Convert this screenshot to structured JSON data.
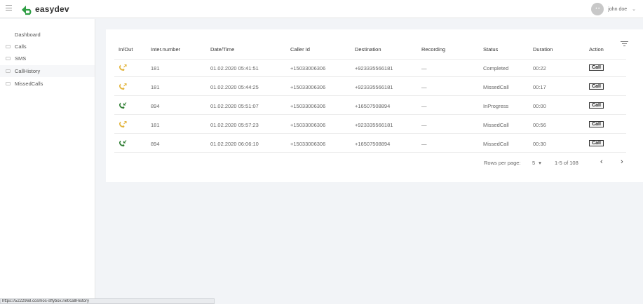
{
  "header": {
    "brand": "easydev",
    "avatar_text": "• •",
    "username": "john doe",
    "dropdown_glyph": "⌄"
  },
  "sidebar": {
    "items": [
      {
        "label": "Dashboard",
        "icon": "none"
      },
      {
        "label": "Calls",
        "icon": "list-icon"
      },
      {
        "label": "SMS",
        "icon": "list-icon"
      },
      {
        "label": "CallHistory",
        "icon": "list-icon",
        "active": true
      },
      {
        "label": "MissedCalls",
        "icon": "list-icon"
      }
    ]
  },
  "table": {
    "columns": [
      "In/Out",
      "Inter.number",
      "Date/Time",
      "Caller Id",
      "Destination",
      "Recording",
      "Status",
      "Duration",
      "Action"
    ],
    "rows": [
      {
        "direction": "outgoing",
        "inter": "181",
        "datetime": "01.02.2020 05:41:51",
        "caller": "+15033006306",
        "destination": "+923335566181",
        "recording": "—",
        "status": "Completed",
        "duration": "00:22",
        "action": "Call"
      },
      {
        "direction": "outgoing",
        "inter": "181",
        "datetime": "01.02.2020 05:44:25",
        "caller": "+15033006306",
        "destination": "+923335566181",
        "recording": "—",
        "status": "MissedCall",
        "duration": "00:17",
        "action": "Call"
      },
      {
        "direction": "incoming",
        "inter": "894",
        "datetime": "01.02.2020 05:51:07",
        "caller": "+15033006306",
        "destination": "+16507508894",
        "recording": "—",
        "status": "InProgress",
        "duration": "00:00",
        "action": "Call"
      },
      {
        "direction": "outgoing",
        "inter": "181",
        "datetime": "01.02.2020 05:57:23",
        "caller": "+15033006306",
        "destination": "+923335566181",
        "recording": "—",
        "status": "MissedCall",
        "duration": "00:56",
        "action": "Call"
      },
      {
        "direction": "incoming",
        "inter": "894",
        "datetime": "01.02.2020 06:06:10",
        "caller": "+15033006306",
        "destination": "+16507508894",
        "recording": "—",
        "status": "MissedCall",
        "duration": "00:30",
        "action": "Call"
      }
    ]
  },
  "pagination": {
    "rows_label": "Rows per page:",
    "rows_value": "5",
    "range": "1-5 of 108",
    "prev": "‹",
    "next": "›"
  },
  "statusbar": {
    "url": "https://5222968.cosmos-sffybox.net/callHistory"
  },
  "colors": {
    "outgoing": "#e2b33a",
    "incoming": "#2e7d32",
    "brand_green": "#2f9e44"
  }
}
